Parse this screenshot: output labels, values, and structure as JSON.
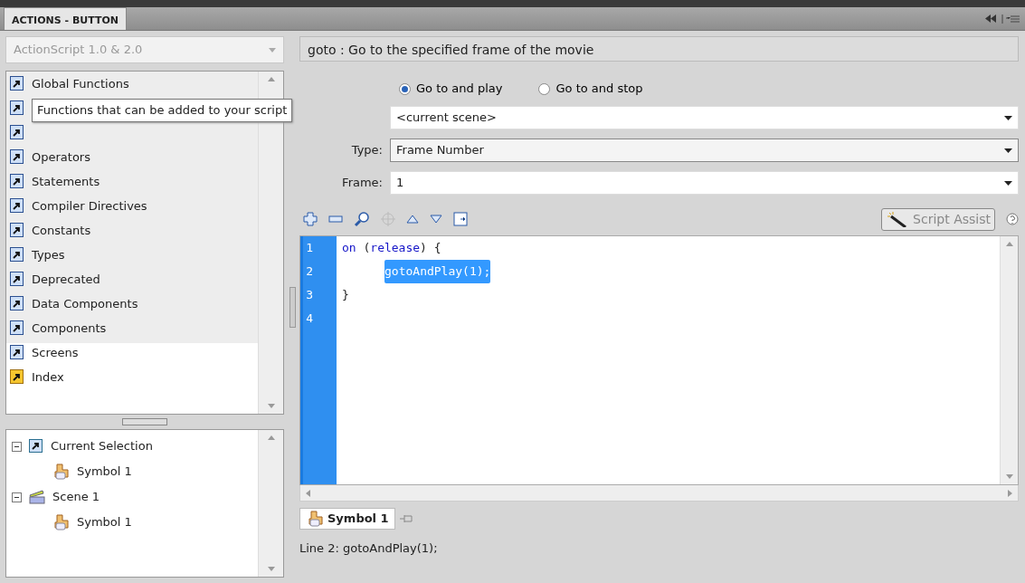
{
  "panel": {
    "title": "ACTIONS - BUTTON"
  },
  "language_select": {
    "value": "ActionScript 1.0 & 2.0"
  },
  "toolbox": [
    {
      "label": "Global Functions",
      "kind": "book"
    },
    {
      "kind": "book"
    },
    {
      "kind": "book"
    },
    {
      "label": "Operators",
      "kind": "book"
    },
    {
      "label": "Statements",
      "kind": "book"
    },
    {
      "label": "Compiler Directives",
      "kind": "book"
    },
    {
      "label": "Constants",
      "kind": "book"
    },
    {
      "label": "Types",
      "kind": "book"
    },
    {
      "label": "Deprecated",
      "kind": "book"
    },
    {
      "label": "Data Components",
      "kind": "book"
    },
    {
      "label": "Components",
      "kind": "book"
    },
    {
      "label": "Screens",
      "kind": "book"
    },
    {
      "label": "Index",
      "kind": "index"
    }
  ],
  "tooltip": "Functions that can be added to your script",
  "tree": [
    {
      "label": "Current Selection",
      "kind": "selection",
      "expanded": true,
      "children": [
        {
          "label": "Symbol 1",
          "kind": "symbol"
        }
      ]
    },
    {
      "label": "Scene 1",
      "kind": "scene",
      "expanded": true,
      "children": [
        {
          "label": "Symbol 1",
          "kind": "symbol"
        }
      ]
    }
  ],
  "description": "goto : Go to the specified frame of the movie",
  "radios": [
    {
      "label": "Go to and play",
      "selected": true
    },
    {
      "label": "Go to and stop",
      "selected": false
    }
  ],
  "fields": [
    {
      "value": "<current scene>"
    },
    {
      "label": "Type:",
      "value": "Frame Number"
    },
    {
      "label": "Frame:",
      "value": "1"
    }
  ],
  "script_assist": "Script Assist",
  "code": [
    {
      "number": "1",
      "selected": false,
      "tokens": [
        {
          "text": "on",
          "kind": "keyword"
        },
        {
          "text": " (",
          "kind": "plain"
        },
        {
          "text": "release",
          "kind": "keyword"
        },
        {
          "text": ") {",
          "kind": "plain"
        }
      ]
    },
    {
      "number": "2",
      "selected": true,
      "indented": true,
      "tokens": [
        {
          "text": "gotoAndPlay(1);",
          "kind": "plain"
        }
      ]
    },
    {
      "number": "3",
      "selected": false,
      "tokens": [
        {
          "text": "}",
          "kind": "plain"
        }
      ]
    },
    {
      "number": "4",
      "selected": false
    }
  ],
  "script_tab": "Symbol 1",
  "status_line": "Line 2: gotoAndPlay(1);"
}
